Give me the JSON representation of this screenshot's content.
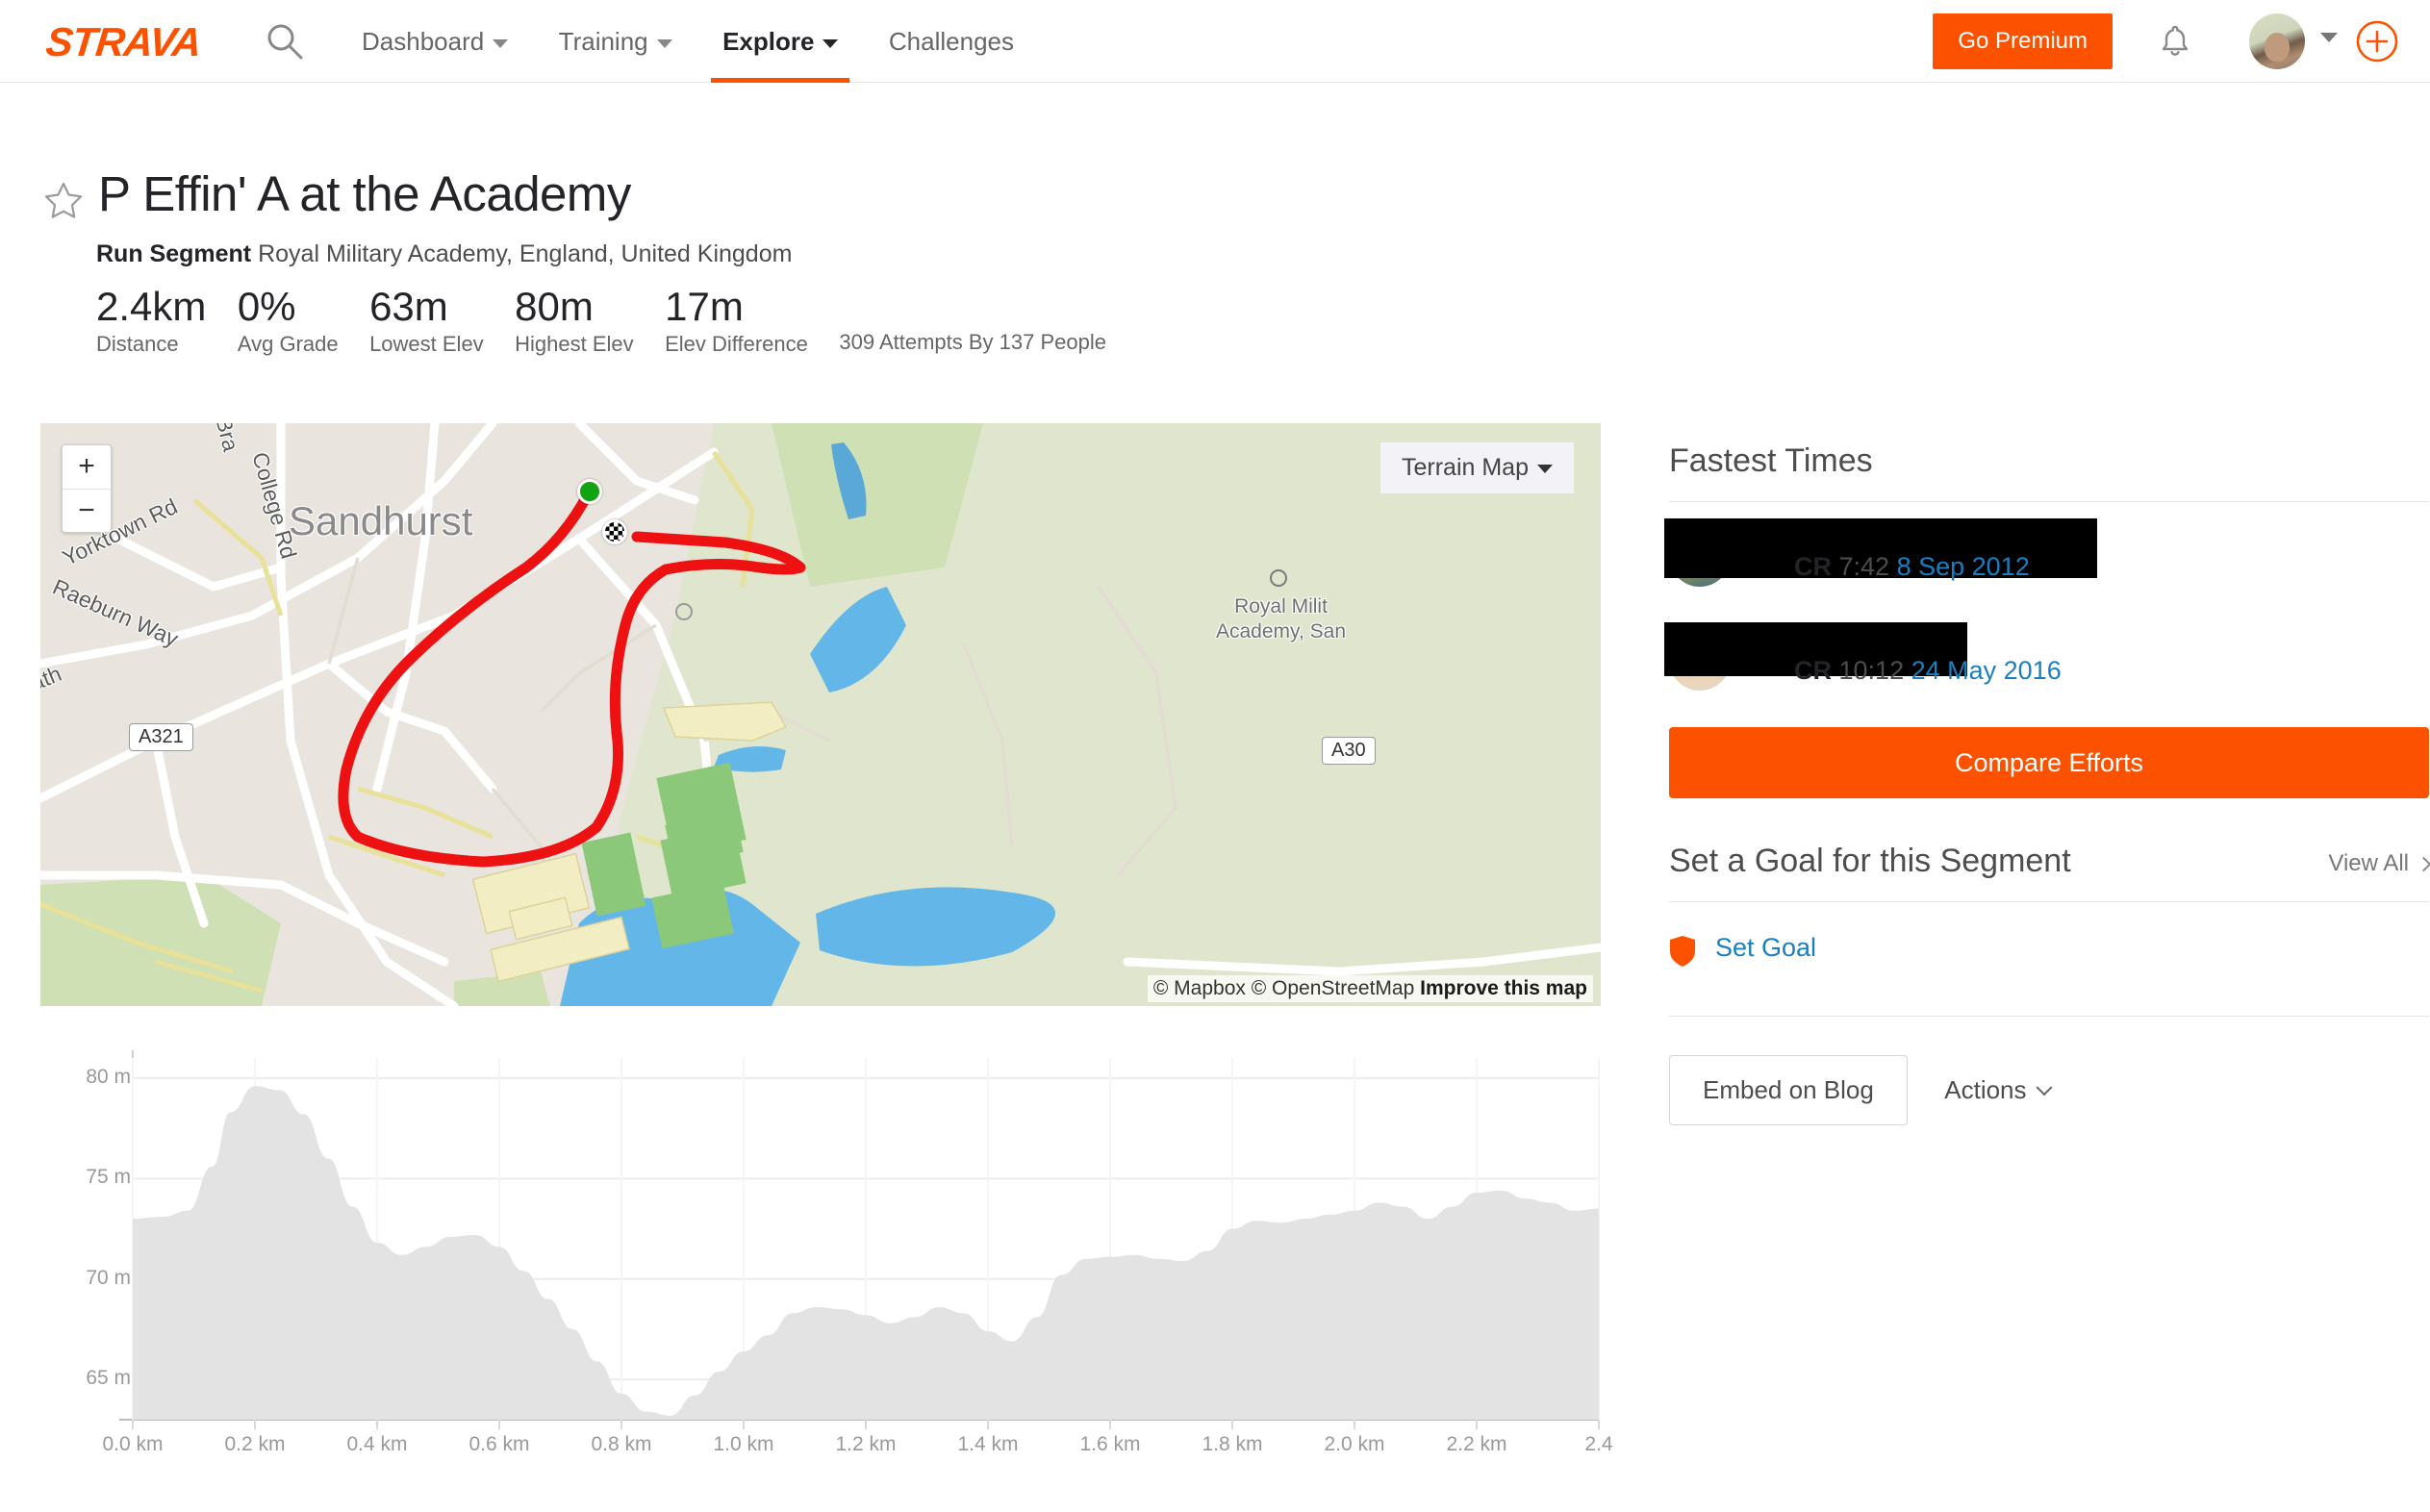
{
  "header": {
    "logo": "STRAVA",
    "search_icon": "search-icon",
    "nav": [
      {
        "label": "Dashboard",
        "has_caret": true,
        "active": false
      },
      {
        "label": "Training",
        "has_caret": true,
        "active": false
      },
      {
        "label": "Explore",
        "has_caret": true,
        "active": true
      },
      {
        "label": "Challenges",
        "has_caret": false,
        "active": false
      }
    ],
    "go_premium": "Go Premium",
    "notifications_icon": "bell-icon",
    "add_icon": "plus-circle-icon",
    "accent_color": "#fc5200"
  },
  "segment": {
    "star_icon": "star-outline-icon",
    "title": "P Effin' A at the Academy",
    "type_label": "Run Segment",
    "location": "Royal Military Academy, England, United Kingdom",
    "stats": [
      {
        "value": "2.4km",
        "label": "Distance"
      },
      {
        "value": "0%",
        "label": "Avg Grade"
      },
      {
        "value": "63m",
        "label": "Lowest Elev"
      },
      {
        "value": "80m",
        "label": "Highest Elev"
      },
      {
        "value": "17m",
        "label": "Elev Difference"
      }
    ],
    "attempts": "309 Attempts By 137 People"
  },
  "map": {
    "zoom_in": "+",
    "zoom_out": "−",
    "layer_selector": "Terrain Map",
    "attribution_prefix": "© Mapbox © OpenStreetMap ",
    "attribution_link": "Improve this map",
    "place_label": "Sandhurst",
    "poi_label": "Royal Milit…\nAcademy, San",
    "poi_line1": "Royal Milit",
    "poi_line2": "Academy, San",
    "roads": [
      {
        "name": "Yorktown Rd"
      },
      {
        "name": "College Rd"
      },
      {
        "name": "Raeburn Way"
      },
      {
        "name": "Bra"
      },
      {
        "name": "ath"
      }
    ],
    "shields": [
      "A321",
      "A30"
    ],
    "route_color": "#ee1111",
    "start_marker": "start-dot-green",
    "finish_marker": "finish-checkered-flag"
  },
  "chart_data": {
    "type": "area",
    "title": "",
    "xlabel": "",
    "ylabel": "",
    "xlim": [
      0,
      2.4
    ],
    "ylim": [
      63,
      81
    ],
    "yticks": [
      65,
      70,
      75,
      80
    ],
    "ytick_labels": [
      "65 m",
      "70 m",
      "75 m",
      "80 m"
    ],
    "xticks": [
      0.0,
      0.2,
      0.4,
      0.6,
      0.8,
      1.0,
      1.2,
      1.4,
      1.6,
      1.8,
      2.0,
      2.2,
      2.4
    ],
    "xtick_labels": [
      "0.0 km",
      "0.2 km",
      "0.4 km",
      "0.6 km",
      "0.8 km",
      "1.0 km",
      "1.2 km",
      "1.4 km",
      "1.6 km",
      "1.8 km",
      "2.0 km",
      "2.2 km",
      "2.4"
    ],
    "grid": true,
    "legend": "none",
    "area_color": "#e3e3e3",
    "x": [
      0.0,
      0.05,
      0.09,
      0.13,
      0.16,
      0.2,
      0.24,
      0.28,
      0.32,
      0.36,
      0.4,
      0.44,
      0.48,
      0.52,
      0.56,
      0.6,
      0.64,
      0.68,
      0.72,
      0.76,
      0.8,
      0.84,
      0.88,
      0.92,
      0.96,
      1.0,
      1.04,
      1.08,
      1.12,
      1.16,
      1.2,
      1.24,
      1.28,
      1.32,
      1.36,
      1.4,
      1.44,
      1.48,
      1.52,
      1.56,
      1.6,
      1.64,
      1.68,
      1.72,
      1.76,
      1.8,
      1.84,
      1.88,
      1.92,
      1.96,
      2.0,
      2.04,
      2.08,
      2.12,
      2.16,
      2.2,
      2.24,
      2.28,
      2.32,
      2.36,
      2.4
    ],
    "y": [
      73.0,
      73.1,
      73.4,
      75.6,
      78.3,
      79.6,
      79.4,
      78.2,
      76.0,
      73.6,
      71.8,
      71.2,
      71.6,
      72.1,
      72.2,
      71.6,
      70.4,
      69.0,
      67.5,
      65.9,
      64.3,
      63.4,
      63.2,
      64.2,
      65.4,
      66.4,
      67.2,
      68.3,
      68.6,
      68.5,
      68.2,
      67.8,
      68.1,
      68.6,
      68.3,
      67.4,
      66.9,
      68.1,
      70.2,
      71.0,
      71.1,
      71.2,
      71.0,
      70.9,
      71.4,
      72.5,
      72.9,
      72.8,
      73.0,
      73.2,
      73.4,
      73.8,
      73.6,
      73.0,
      73.6,
      74.3,
      74.4,
      74.0,
      73.8,
      73.4,
      73.5
    ]
  },
  "sidebar": {
    "fastest_times_heading": "Fastest Times",
    "efforts": [
      {
        "badge": "CR",
        "time": "7:42",
        "date": "8 Sep 2012",
        "name_redacted": true
      },
      {
        "badge": "CR",
        "time": "10:12",
        "date": "24 May 2016",
        "name_redacted": true
      }
    ],
    "compare_button": "Compare Efforts",
    "goal_heading": "Set a Goal for this Segment",
    "view_all": "View All",
    "goal_link": "Set Goal",
    "goal_icon": "shield-icon",
    "embed_button": "Embed on Blog",
    "actions_button": "Actions",
    "link_color": "#1a7fc1"
  }
}
